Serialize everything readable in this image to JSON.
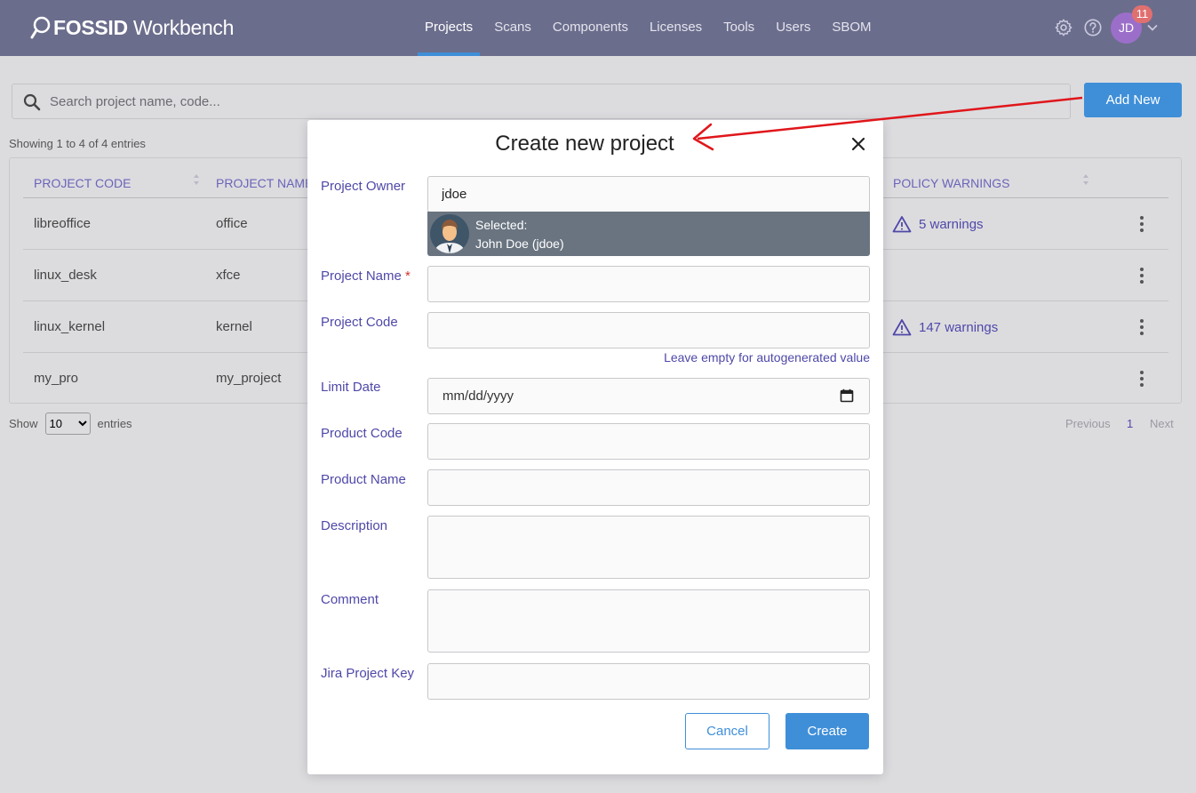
{
  "header": {
    "logo_bold": "FOSSID",
    "logo_light": " Workbench",
    "nav": [
      "Projects",
      "Scans",
      "Components",
      "Licenses",
      "Tools",
      "Users",
      "SBOM"
    ],
    "active_nav": "Projects",
    "avatar_initials": "JD",
    "notification_count": "11"
  },
  "search": {
    "placeholder": "Search project name, code...",
    "add_new_label": "Add New"
  },
  "table": {
    "showing": "Showing 1 to 4 of 4 entries",
    "columns": [
      "PROJECT CODE",
      "PROJECT NAME",
      "POLICY WARNINGS"
    ],
    "rows": [
      {
        "code": "libreoffice",
        "name": "office",
        "warnings": "5 warnings"
      },
      {
        "code": "linux_desk",
        "name": "xfce",
        "warnings": ""
      },
      {
        "code": "linux_kernel",
        "name": "kernel",
        "warnings": "147 warnings"
      },
      {
        "code": "my_pro",
        "name": "my_project",
        "warnings": ""
      }
    ],
    "show_label": "Show",
    "show_value": "10",
    "entries_label": "entries",
    "pager": {
      "previous": "Previous",
      "page": "1",
      "next": "Next"
    }
  },
  "modal": {
    "title": "Create new project",
    "fields": {
      "owner_label": "Project Owner",
      "owner_value": "jdoe",
      "selected_label": "Selected:",
      "selected_user": "John Doe (jdoe)",
      "name_label": "Project Name",
      "required_mark": "*",
      "code_label": "Project Code",
      "code_hint": "Leave empty for autogenerated value",
      "limit_date_label": "Limit Date",
      "limit_date_placeholder": "mm/dd/yyyy",
      "product_code_label": "Product Code",
      "product_name_label": "Product Name",
      "description_label": "Description",
      "comment_label": "Comment",
      "jira_label": "Jira Project Key"
    },
    "cancel_label": "Cancel",
    "create_label": "Create"
  },
  "colors": {
    "header_bg": "#6b6d8c",
    "accent": "#3f8fd8",
    "label_purple": "#4f48a8",
    "annotation_arrow": "#e0161b"
  }
}
